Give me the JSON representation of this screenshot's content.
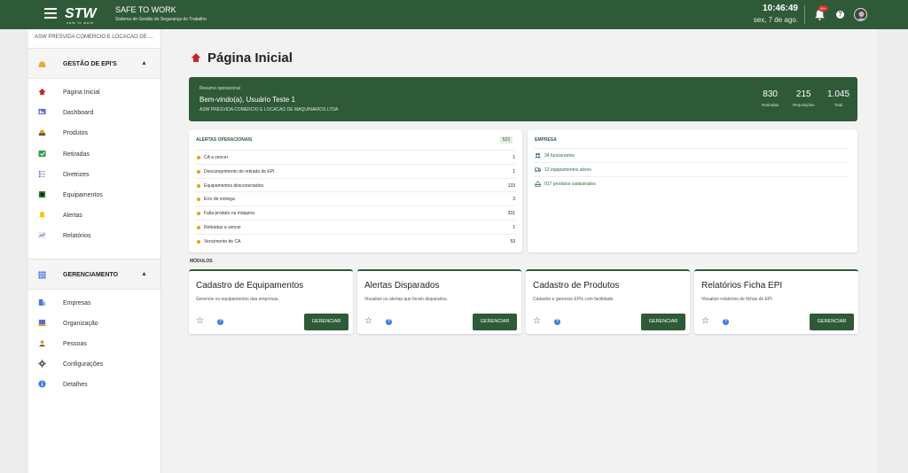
{
  "header": {
    "brand_name": "SAFE TO WORK",
    "brand_sub": "Sistema de Gestão de Segurança do Trabalho",
    "logo_text": "STW",
    "logo_tag": "safe to work",
    "time": "10:46:49",
    "date": "sex, 7 de ago.",
    "notification_badge": "99+",
    "help_glyph": "?",
    "colors": {
      "bar": "#2f5a38",
      "badge": "#d32f2f"
    }
  },
  "sidebar": {
    "company": "ASW PRESVIDA COMERCIO E LOCACAO DE ...",
    "sections": [
      {
        "title": "GESTÃO DE EPI'S",
        "icon": "hardhat-icon",
        "items": [
          {
            "label": "Página Inicial",
            "icon": "home-icon"
          },
          {
            "label": "Dashboard",
            "icon": "dashboard-icon"
          },
          {
            "label": "Produtos",
            "icon": "products-icon"
          },
          {
            "label": "Retiradas",
            "icon": "withdrawals-icon"
          },
          {
            "label": "Diretrizes",
            "icon": "guidelines-icon"
          },
          {
            "label": "Equipamentos",
            "icon": "equipment-icon"
          },
          {
            "label": "Alertas",
            "icon": "bell-icon"
          },
          {
            "label": "Relatórios",
            "icon": "reports-icon"
          }
        ]
      },
      {
        "title": "GERENCIAMENTO",
        "icon": "grid-icon",
        "items": [
          {
            "label": "Empresas",
            "icon": "companies-icon"
          },
          {
            "label": "Organização",
            "icon": "organization-icon"
          },
          {
            "label": "Pessoas",
            "icon": "people-icon"
          },
          {
            "label": "Configurações",
            "icon": "settings-icon"
          },
          {
            "label": "Detalhes",
            "icon": "info-icon"
          }
        ]
      }
    ]
  },
  "page": {
    "title": "Página Inicial"
  },
  "hero": {
    "eyebrow": "Resumo operacional",
    "welcome": "Bem-vindo(a), Usuário Teste 1",
    "company": "ASW PRESVIDA COMERCIO E LOCACAO DE MAQUINARIOS LTDA",
    "stats": [
      {
        "value": "830",
        "label": "Retiradas"
      },
      {
        "value": "215",
        "label": "Requisições"
      },
      {
        "value": "1.045",
        "label": "Total"
      }
    ]
  },
  "alerts": {
    "title": "ALERTAS OPERACIONAIS",
    "total": "523",
    "rows": [
      {
        "label": "CA a vencer",
        "value": "1"
      },
      {
        "label": "Descumprimento de retirada de EPI",
        "value": "1"
      },
      {
        "label": "Equipamentos desconectados",
        "value": "133"
      },
      {
        "label": "Erro de entrega",
        "value": "3"
      },
      {
        "label": "Falta produto na máquina",
        "value": "331"
      },
      {
        "label": "Retiradas a vencer",
        "value": "1"
      },
      {
        "label": "Vencimento de CA",
        "value": "53"
      }
    ]
  },
  "empresa": {
    "title": "EMPRESA",
    "rows": [
      {
        "text": "34 funcionários",
        "icon": "people-icon"
      },
      {
        "text": "12 equipamentos ativos",
        "icon": "truck-icon"
      },
      {
        "text": "917 produtos cadastrados",
        "icon": "box-icon"
      }
    ]
  },
  "modules": {
    "label": "MÓDULOS",
    "button_label": "GERENCIAR",
    "items": [
      {
        "title": "Cadastro de Equipamentos",
        "desc": "Gerencie os equipamentos das empresas."
      },
      {
        "title": "Alertas Disparados",
        "desc": "Visualize os alertas que foram disparados."
      },
      {
        "title": "Cadastro de Produtos",
        "desc": "Cadastre e gerencie EPIs com facilidade."
      },
      {
        "title": "Relatórios Ficha EPI",
        "desc": "Visualize relatórios de fichas de EPI."
      }
    ]
  }
}
